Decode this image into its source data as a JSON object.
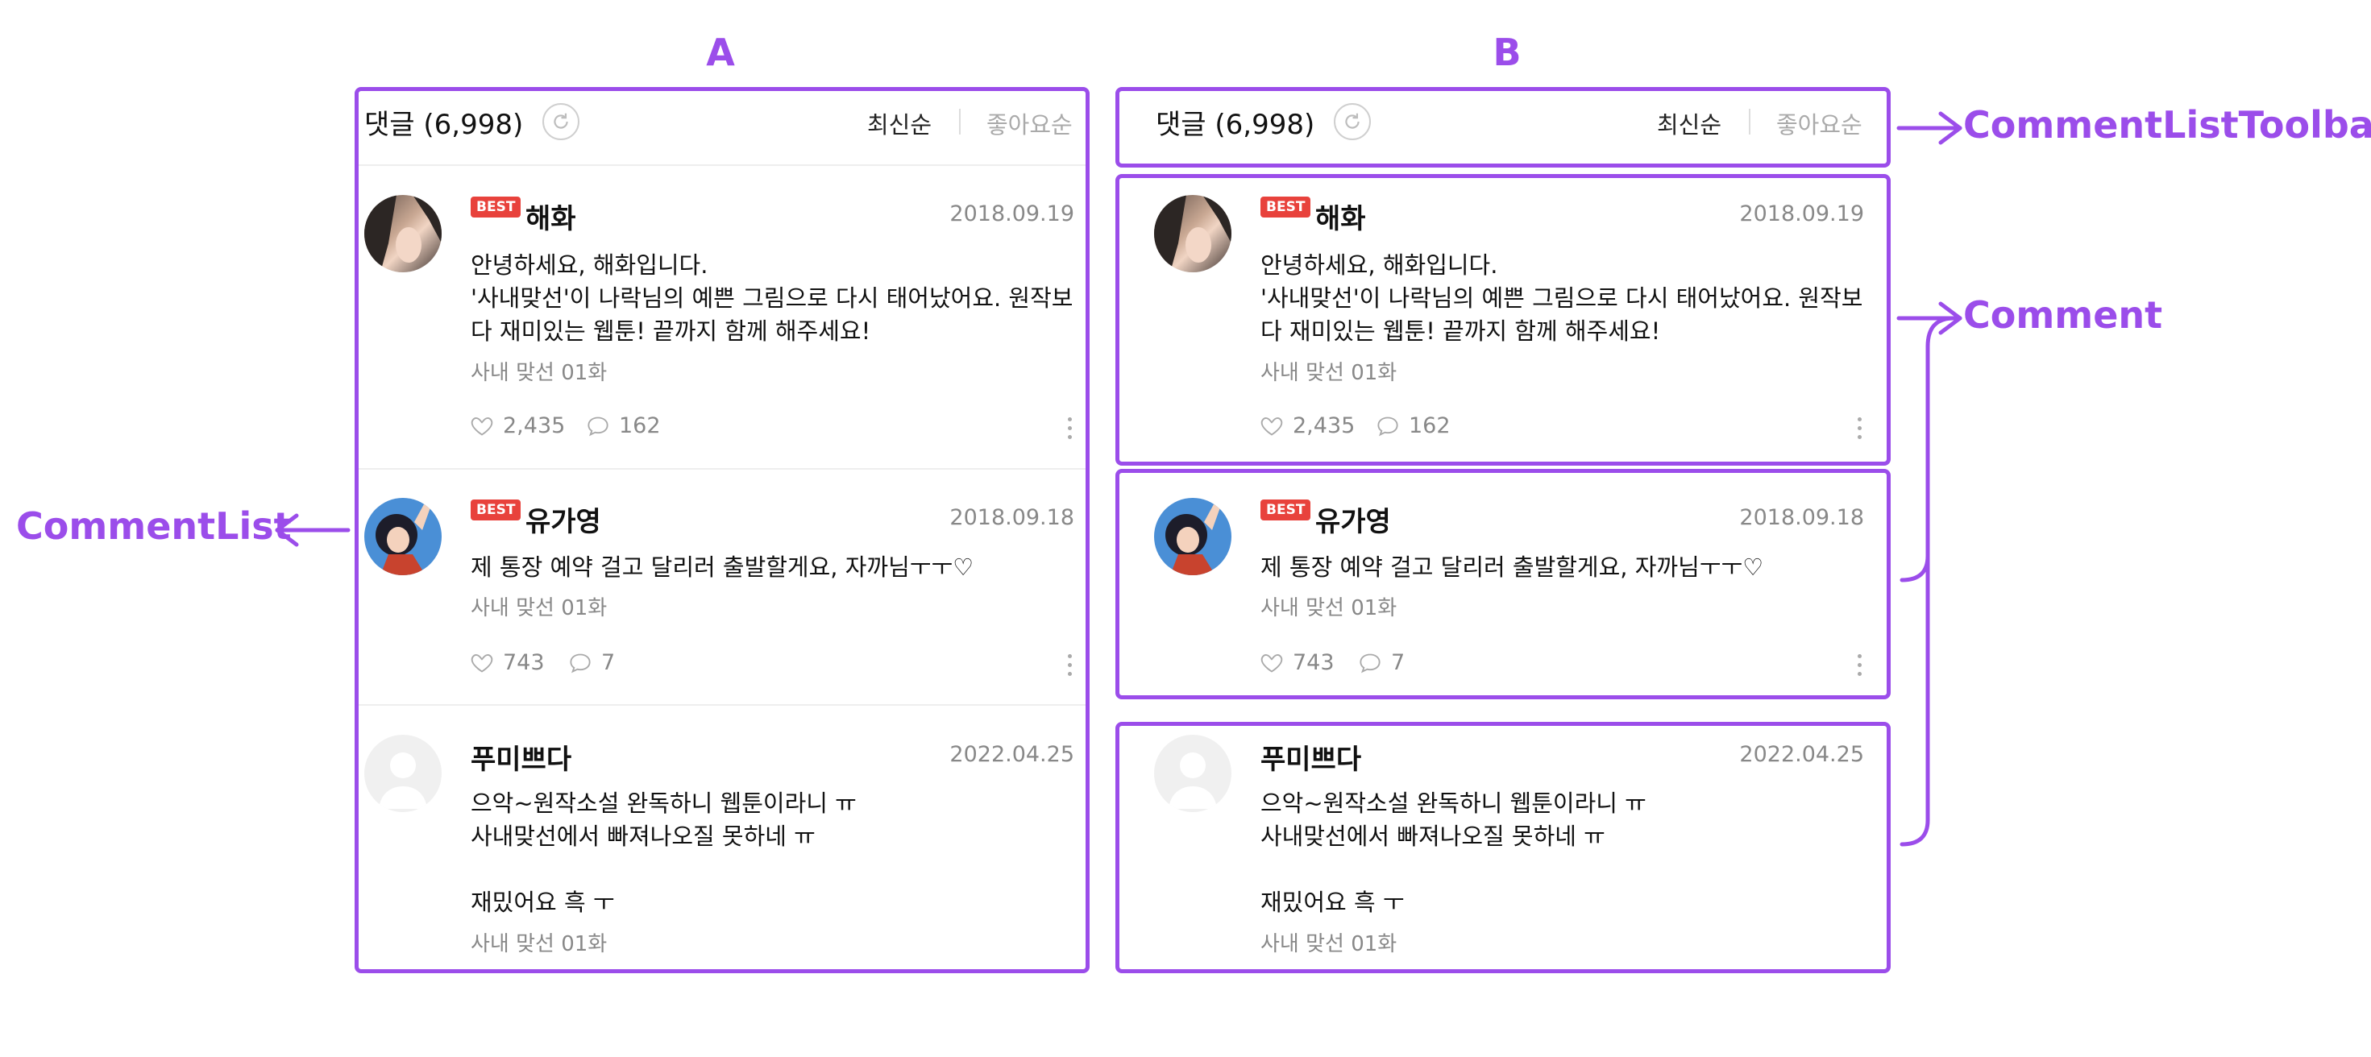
{
  "panels": {
    "a_title": "A",
    "b_title": "B"
  },
  "labels": {
    "comment_list": "CommentList",
    "comment_list_toolbar": "CommentListToolbar",
    "comment": "Comment"
  },
  "toolbar": {
    "title": "댓글 (6,998)",
    "sort_latest": "최신순",
    "sort_likes": "좋아요순"
  },
  "comments": [
    {
      "badge": "BEST",
      "author": "해화",
      "date": "2018.09.19",
      "lines": [
        "안녕하세요, 해화입니다.",
        "'사내맞선'이 나락님의 예쁜 그림으로 다시 태어났어요. 원작보",
        "다 재미있는 웹툰! 끝까지 함께 해주세요!"
      ],
      "episode": "사내 맞선 01화",
      "likes": "2,435",
      "replies": "162"
    },
    {
      "badge": "BEST",
      "author": "유가영",
      "date": "2018.09.18",
      "lines": [
        "제 통장 예약 걸고 달리러 출발할게요, 자까님ㅜㅜ♡"
      ],
      "episode": "사내 맞선 01화",
      "likes": "743",
      "replies": "7"
    },
    {
      "author": "푸미쁘다",
      "date": "2022.04.25",
      "lines": [
        "으악~원작소설 완독하니 웹툰이라니 ㅠ",
        "사내맞선에서 빠져나오질 못하네 ㅠ",
        "",
        "재밌어요 흑 ㅜ"
      ],
      "episode": "사내 맞선 01화"
    }
  ],
  "colors": {
    "accent": "#9b4dea",
    "best_badge": "#e8423c",
    "muted_text": "#888888"
  }
}
